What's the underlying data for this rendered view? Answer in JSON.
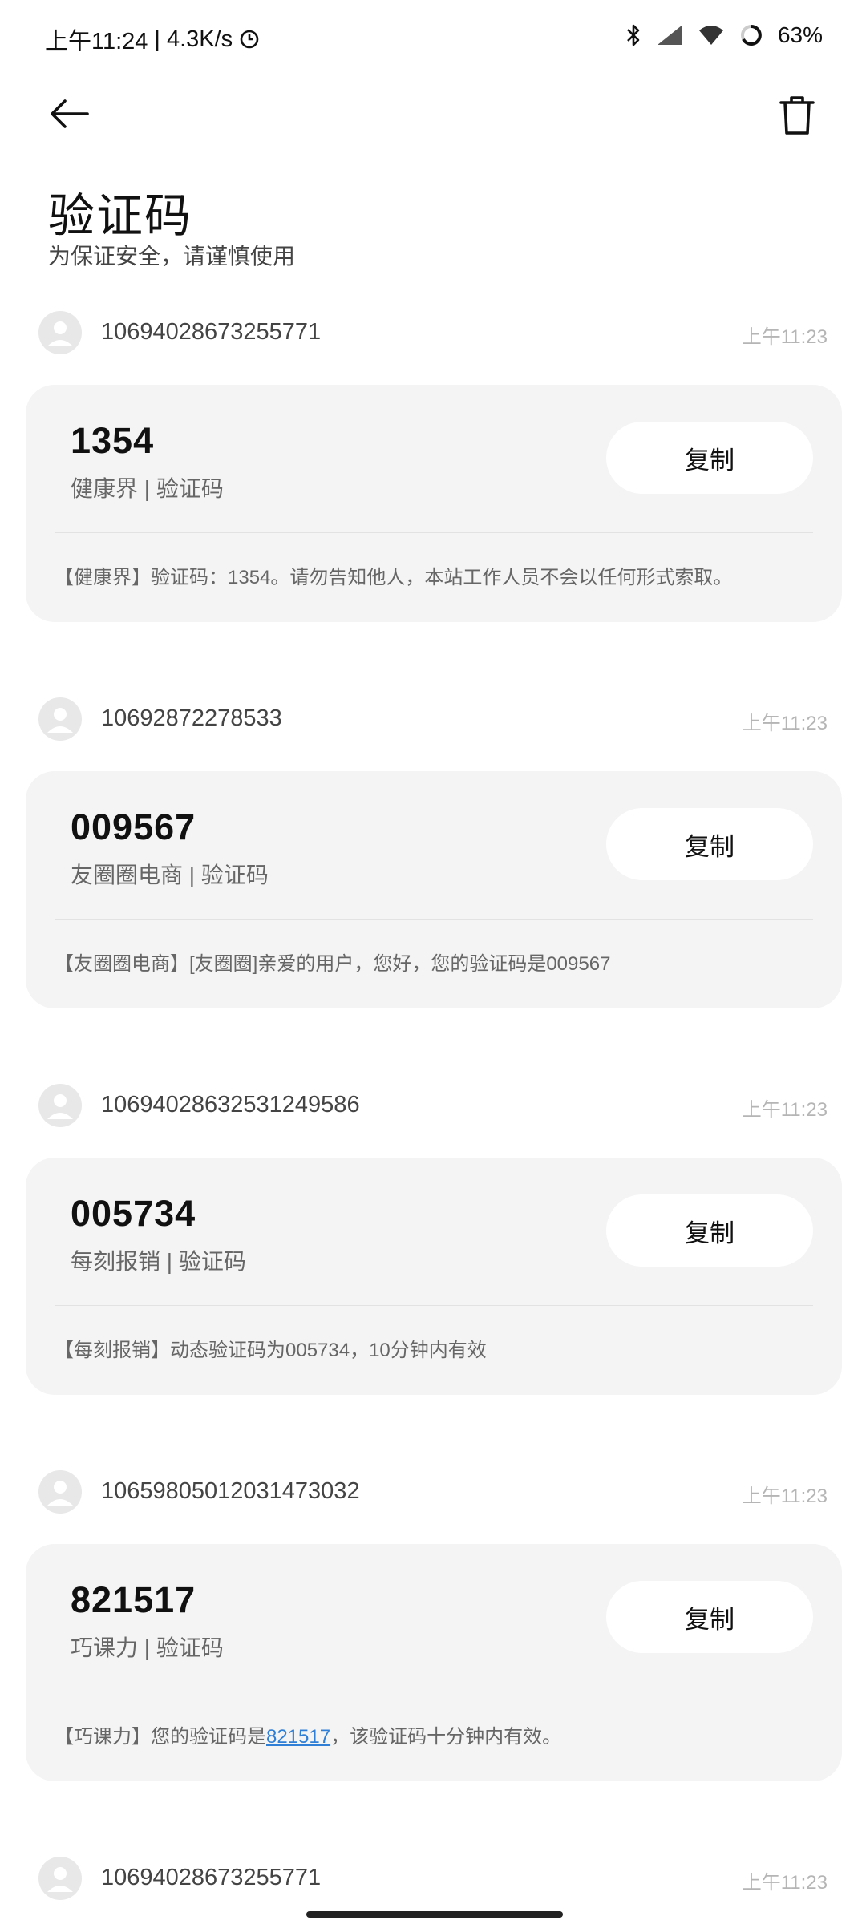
{
  "status_bar": {
    "time": "上午11:24",
    "separator": "|",
    "speed": "4.3K/s",
    "battery": "63%"
  },
  "header": {
    "title": "验证码",
    "subtitle": "为保证安全，请谨慎使用"
  },
  "messages": [
    {
      "sender": "10694028673255771",
      "time": "上午11:23",
      "code": "1354",
      "source": "健康界 | 验证码",
      "copy_label": "复制",
      "body": "【健康界】验证码：1354。请勿告知他人，本站工作人员不会以任何形式索取。"
    },
    {
      "sender": "10692872278533",
      "time": "上午11:23",
      "code": "009567",
      "source": "友圈圈电商 | 验证码",
      "copy_label": "复制",
      "body": "【友圈圈电商】[友圈圈]亲爱的用户，您好，您的验证码是009567"
    },
    {
      "sender": "10694028632531249586",
      "time": "上午11:23",
      "code": "005734",
      "source": "每刻报销 | 验证码",
      "copy_label": "复制",
      "body": "【每刻报销】动态验证码为005734，10分钟内有效"
    },
    {
      "sender": "10659805012031473032",
      "time": "上午11:23",
      "code": "821517",
      "source": "巧课力 | 验证码",
      "copy_label": "复制",
      "body_prefix": "【巧课力】您的验证码是",
      "body_link": "821517",
      "body_suffix": "，该验证码十分钟内有效。"
    },
    {
      "sender": "10694028673255771",
      "time": "上午11:23"
    }
  ],
  "icons": {
    "back": "arrow-left-icon",
    "delete": "trash-icon",
    "avatar": "person-icon",
    "bluetooth": "bluetooth-icon",
    "signal": "signal-icon",
    "wifi": "wifi-icon",
    "battery": "battery-ring-icon",
    "clock": "clock-icon"
  },
  "colors": {
    "card_bg": "#f4f4f4",
    "link": "#2f7fd6",
    "muted_text": "#666666",
    "time_text": "#b5b5b5"
  }
}
